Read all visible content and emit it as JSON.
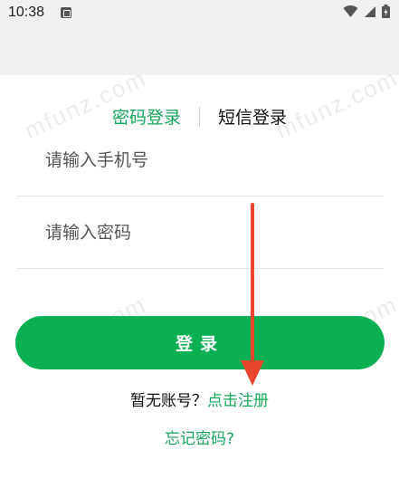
{
  "status_bar": {
    "time": "10:38",
    "icons": [
      "notification-a-icon",
      "wifi-icon",
      "signal-icon",
      "battery-icon"
    ]
  },
  "watermark": "mfunz.com",
  "tabs": [
    {
      "label": "密码登录",
      "active": true
    },
    {
      "label": "短信登录",
      "active": false
    }
  ],
  "form": {
    "phone_placeholder": "请输入手机号",
    "password_placeholder": "请输入密码",
    "login_label": "登录"
  },
  "register": {
    "prompt": "暂无账号？",
    "link": "点击注册"
  },
  "forgot_password": "忘记密码?",
  "colors": {
    "accent": "#16a65a",
    "button": "#0bb055",
    "annotation_arrow": "#e8452c"
  }
}
